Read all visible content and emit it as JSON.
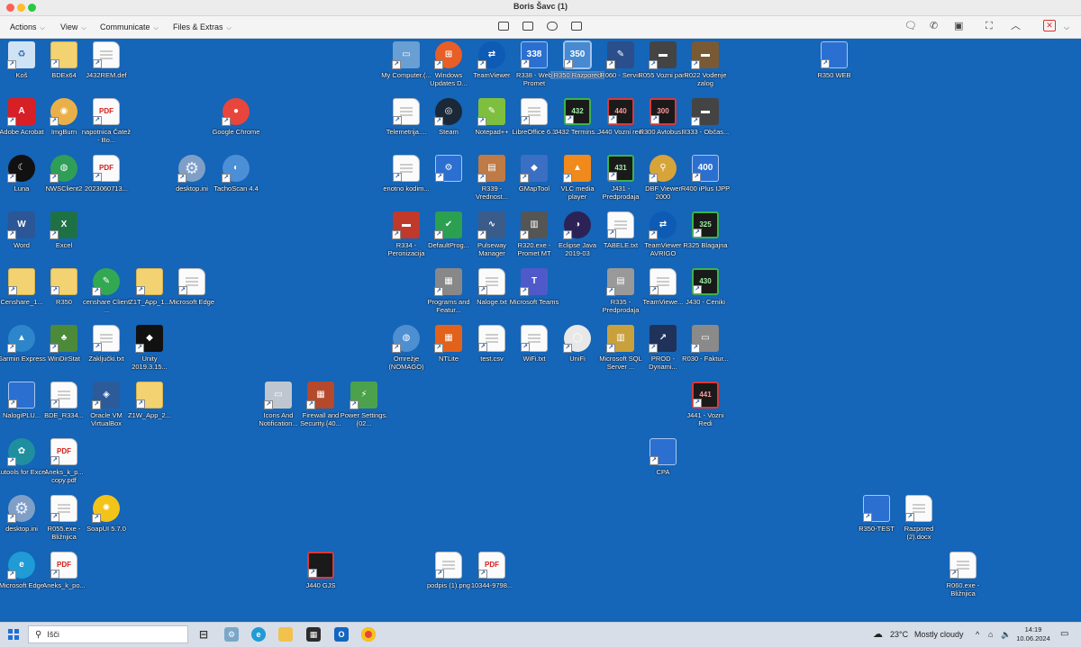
{
  "window": {
    "title": "Boris Šavc (1)"
  },
  "toolbar": {
    "menus": [
      {
        "label": "Actions"
      },
      {
        "label": "View"
      },
      {
        "label": "Communicate"
      },
      {
        "label": "Files & Extras"
      }
    ]
  },
  "desktop": {
    "background_color": "#1565b8",
    "icons": [
      {
        "label": "Koš",
        "icon": "recycle-bin-icon"
      },
      {
        "label": "BDEx64",
        "icon": "folder-icon"
      },
      {
        "label": "J432REM.def",
        "icon": "file-icon"
      },
      {
        "label": "Adobe Acrobat",
        "icon": "acrobat-icon"
      },
      {
        "label": "ImgBurn",
        "icon": "disc-icon"
      },
      {
        "label": "napotnica Čatež - Bo...",
        "icon": "pdf-icon"
      },
      {
        "label": "Google Chrome",
        "icon": "chrome-icon"
      },
      {
        "label": "Luna",
        "icon": "moon-icon"
      },
      {
        "label": "NWSClient2",
        "icon": "globe-icon"
      },
      {
        "label": "2023060713...",
        "icon": "pdf-icon"
      },
      {
        "label": "desktop.ini",
        "icon": "gear-file-icon"
      },
      {
        "label": "TachoScan 4.4",
        "icon": "tachoscan-icon"
      },
      {
        "label": "Word",
        "icon": "word-icon"
      },
      {
        "label": "Excel",
        "icon": "excel-icon"
      },
      {
        "label": "Censhare_1...",
        "icon": "folder-icon"
      },
      {
        "label": "R350",
        "icon": "folder-icon"
      },
      {
        "label": "censhare Client ...",
        "icon": "censhare-icon"
      },
      {
        "label": "Z1T_App_1...",
        "icon": "folder-icon"
      },
      {
        "label": "Microsoft Edge",
        "icon": "file-icon"
      },
      {
        "label": "Garmin Express",
        "icon": "garmin-icon"
      },
      {
        "label": "WinDirStat",
        "icon": "tree-icon"
      },
      {
        "label": "Zaključki.txt",
        "icon": "file-icon"
      },
      {
        "label": "Unity 2019.3.15...",
        "icon": "unity-icon"
      },
      {
        "label": "NalogiPLU...",
        "icon": "window-icon"
      },
      {
        "label": "BDE_R334...",
        "icon": "text-file-icon"
      },
      {
        "label": "Oracle VM VirtualBox",
        "icon": "virtualbox-icon"
      },
      {
        "label": "Z1W_App_2...",
        "icon": "folder-icon"
      },
      {
        "label": "Icons And Notification...",
        "icon": "notification-icon"
      },
      {
        "label": "Firewall and Security.{40...",
        "icon": "firewall-icon"
      },
      {
        "label": "Power Settings.{02...",
        "icon": "power-icon"
      },
      {
        "label": "Kutools for Excel",
        "icon": "kutools-icon"
      },
      {
        "label": "Aneks_k_p... copy.pdf",
        "icon": "pdf-icon"
      },
      {
        "label": "desktop.ini",
        "icon": "gear-file-icon"
      },
      {
        "label": "R055.exe - Bližnjica",
        "icon": "file-icon"
      },
      {
        "label": "SoapUI 5.7.0",
        "icon": "soapui-icon"
      },
      {
        "label": "Microsoft Edge",
        "icon": "edge-icon"
      },
      {
        "label": "Aneks_k_po...",
        "icon": "pdf-icon"
      },
      {
        "label": "J440 GJS",
        "icon": "app-red-icon"
      },
      {
        "label": "podpis (1).png",
        "icon": "image-icon"
      },
      {
        "label": "10344-9798...",
        "icon": "pdf-icon"
      },
      {
        "label": "My Computer.(...",
        "icon": "computer-icon"
      },
      {
        "label": "Windows Updates D...",
        "icon": "windows-icon"
      },
      {
        "label": "TeamViewer",
        "icon": "teamviewer-icon"
      },
      {
        "label": "R338 - Web Promet",
        "icon": "app-blue-icon",
        "badge": "338"
      },
      {
        "label": "R350 Razpored",
        "icon": "app-blue-icon",
        "badge": "350",
        "selected": true
      },
      {
        "label": "R060 - Servis",
        "icon": "wrench-icon"
      },
      {
        "label": "R055 Vozni park",
        "icon": "bus-icon"
      },
      {
        "label": "R022 Vodenje zalog",
        "icon": "truck-icon"
      },
      {
        "label": "Telemetrija....",
        "icon": "file-icon"
      },
      {
        "label": "Steam",
        "icon": "steam-icon"
      },
      {
        "label": "Notepad++",
        "icon": "notepad-icon"
      },
      {
        "label": "LibreOffice 6.3",
        "icon": "file-icon"
      },
      {
        "label": "J432 Termins...",
        "icon": "app-green-icon",
        "badge": "432"
      },
      {
        "label": "J440 Vozni redi",
        "icon": "app-red-icon",
        "badge": "440"
      },
      {
        "label": "R300 Avtobus...",
        "icon": "app-red-icon",
        "badge": "300"
      },
      {
        "label": "R333 - Občas...",
        "icon": "bus-icon"
      },
      {
        "label": "enotno kodim...",
        "icon": "file-icon"
      },
      {
        "label": "",
        "icon": "window-settings-icon"
      },
      {
        "label": "R339 - Vrednost...",
        "icon": "photo-icon"
      },
      {
        "label": "GMapTool",
        "icon": "diamond-icon"
      },
      {
        "label": "VLC media player",
        "icon": "vlc-icon"
      },
      {
        "label": "J431 - Predprodaja",
        "icon": "app-green-icon",
        "badge": "431"
      },
      {
        "label": "DBF Viewer 2000",
        "icon": "magnifier-icon"
      },
      {
        "label": "R400 iPlus IJPP",
        "icon": "app-blue-icon",
        "badge": "400"
      },
      {
        "label": "R334 - Peronizacija",
        "icon": "bus-red-icon"
      },
      {
        "label": "DefaultProg...",
        "icon": "check-icon"
      },
      {
        "label": "Pulseway Manager",
        "icon": "pulse-icon"
      },
      {
        "label": "R320.exe - Promet MT",
        "icon": "ticket-icon"
      },
      {
        "label": "Eclipse Java 2019-03",
        "icon": "eclipse-icon"
      },
      {
        "label": "TABELE.txt",
        "icon": "file-icon"
      },
      {
        "label": "TeamViewer AVRIGO",
        "icon": "teamviewer-icon"
      },
      {
        "label": "R325 Blagajna",
        "icon": "app-green-icon",
        "badge": "325"
      },
      {
        "label": "Programs and Featur...",
        "icon": "programs-icon"
      },
      {
        "label": "Naloge.txt",
        "icon": "file-icon"
      },
      {
        "label": "Microsoft Teams",
        "icon": "teams-icon"
      },
      {
        "label": "R335 - Predprodaja",
        "icon": "printer-icon"
      },
      {
        "label": "TeamViewe...",
        "icon": "file-icon"
      },
      {
        "label": "J430 - Ceniki",
        "icon": "app-green-icon",
        "badge": "430"
      },
      {
        "label": "Omrežje (NOMAGO)",
        "icon": "network-icon"
      },
      {
        "label": "NTLite",
        "icon": "ntlite-icon"
      },
      {
        "label": "test.csv",
        "icon": "csv-icon"
      },
      {
        "label": "WiFi.txt",
        "icon": "file-icon"
      },
      {
        "label": "UniFi",
        "icon": "unifi-icon"
      },
      {
        "label": "Microsoft SQL Server ...",
        "icon": "sql-icon"
      },
      {
        "label": "PROD - Dynami...",
        "icon": "chart-icon"
      },
      {
        "label": "R030 - Faktur...",
        "icon": "scanner-icon"
      },
      {
        "label": "J441 - Vozni Redi",
        "icon": "app-red-icon",
        "badge": "441"
      },
      {
        "label": "CPA",
        "icon": "window-icon"
      },
      {
        "label": "R350 WEB",
        "icon": "app-blue-icon"
      },
      {
        "label": "R350-TEST",
        "icon": "window-icon"
      },
      {
        "label": "Razpored (2).docx",
        "icon": "word-file-icon"
      },
      {
        "label": "R060.exe - Bližnjica",
        "icon": "file-icon"
      }
    ]
  },
  "taskbar": {
    "search_placeholder": "Išči",
    "apps": [
      "task-view-icon",
      "tools-icon",
      "edge-icon",
      "file-explorer-icon",
      "store-icon",
      "outlook-icon",
      "chrome-icon"
    ],
    "weather_temp": "23°C",
    "weather_text": "Mostly cloudy",
    "time": "14:19",
    "date": "10.06.2024"
  }
}
